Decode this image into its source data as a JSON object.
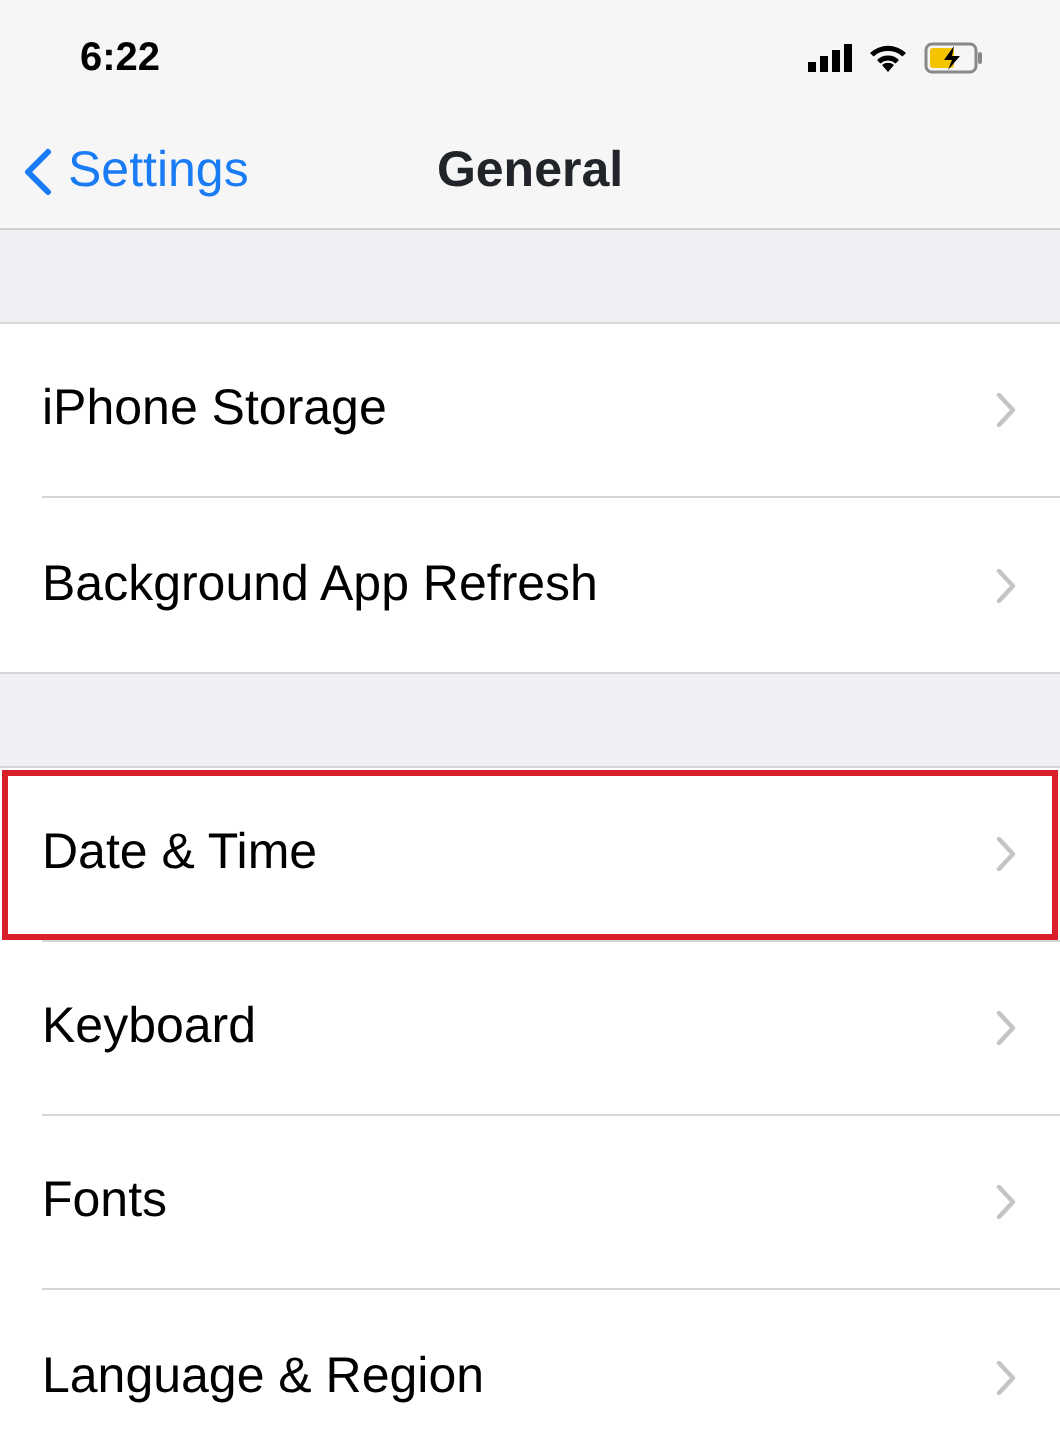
{
  "status_bar": {
    "time": "6:22"
  },
  "nav": {
    "back": "Settings",
    "title": "General"
  },
  "groups": [
    {
      "rows": [
        {
          "label": "iPhone Storage",
          "highlighted": false
        },
        {
          "label": "Background App Refresh",
          "highlighted": false
        }
      ]
    },
    {
      "rows": [
        {
          "label": "Date & Time",
          "highlighted": true
        },
        {
          "label": "Keyboard",
          "highlighted": false
        },
        {
          "label": "Fonts",
          "highlighted": false
        },
        {
          "label": "Language & Region",
          "highlighted": false
        }
      ]
    }
  ]
}
